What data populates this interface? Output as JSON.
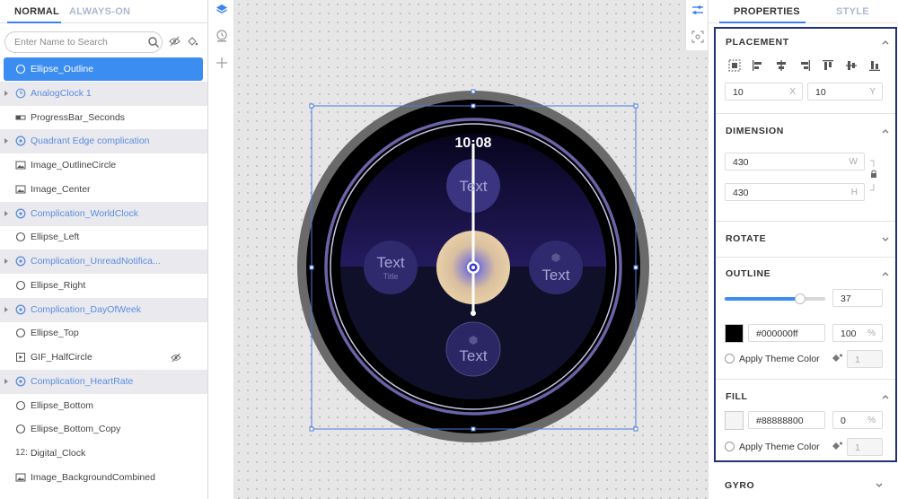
{
  "left_panel": {
    "tabs": [
      "NORMAL",
      "ALWAYS-ON"
    ],
    "search_placeholder": "Enter Name to Search",
    "layers": [
      {
        "label": "Ellipse_Outline",
        "icon": "ellipse-icon",
        "group": false,
        "selected": true
      },
      {
        "label": "AnalogClock 1",
        "icon": "clock-icon",
        "group": true
      },
      {
        "label": "ProgressBar_Seconds",
        "icon": "progressbar-icon",
        "group": false
      },
      {
        "label": "Quadrant Edge complication",
        "icon": "complication-icon",
        "group": true
      },
      {
        "label": "Image_OutlineCircle",
        "icon": "image-icon",
        "group": false
      },
      {
        "label": "Image_Center",
        "icon": "image-icon",
        "group": false
      },
      {
        "label": "Complication_WorldClock",
        "icon": "complication-icon",
        "group": true
      },
      {
        "label": "Ellipse_Left",
        "icon": "ellipse-icon",
        "group": false
      },
      {
        "label": "Complication_UnreadNotifica...",
        "icon": "complication-icon",
        "group": true
      },
      {
        "label": "Ellipse_Right",
        "icon": "ellipse-icon",
        "group": false
      },
      {
        "label": "Complication_DayOfWeek",
        "icon": "complication-icon",
        "group": true
      },
      {
        "label": "Ellipse_Top",
        "icon": "ellipse-icon",
        "group": false
      },
      {
        "label": "GIF_HalfCircle",
        "icon": "gif-icon",
        "group": false,
        "hidden": true
      },
      {
        "label": "Complication_HeartRate",
        "icon": "complication-icon",
        "group": true
      },
      {
        "label": "Ellipse_Bottom",
        "icon": "ellipse-icon",
        "group": false
      },
      {
        "label": "Ellipse_Bottom_Copy",
        "icon": "ellipse-icon",
        "group": false
      },
      {
        "label": "Digital_Clock",
        "icon": "digital-clock-icon",
        "glyph": "12:",
        "group": false
      },
      {
        "label": "Image_BackgroundCombined",
        "icon": "image-icon",
        "group": false
      }
    ]
  },
  "canvas": {
    "time": "10:08",
    "complications": {
      "top": "Text",
      "left": "Text",
      "left_sub": "Title",
      "right": "Text",
      "bottom": "Text"
    }
  },
  "properties": {
    "tabs": [
      "PROPERTIES",
      "STYLE"
    ],
    "placement": {
      "title": "PLACEMENT",
      "x": "10",
      "x_unit": "X",
      "y": "10",
      "y_unit": "Y"
    },
    "dimension": {
      "title": "DIMENSION",
      "w": "430",
      "w_unit": "W",
      "h": "430",
      "h_unit": "H"
    },
    "rotate": {
      "title": "ROTATE"
    },
    "outline": {
      "title": "OUTLINE",
      "slider_value": "37",
      "slider_fraction": 0.75,
      "color": "#000000ff",
      "opacity": "100",
      "unit": "%",
      "apply_theme": "Apply Theme Color",
      "theme_value": "1"
    },
    "fill": {
      "title": "FILL",
      "color": "#88888800",
      "opacity": "0",
      "unit": "%",
      "apply_theme": "Apply Theme Color",
      "theme_value": "1"
    },
    "gyro": {
      "title": "GYRO"
    }
  },
  "colors": {
    "accent": "#3c8df2",
    "group_row": "#e9e9ee",
    "group_text": "#5b8de0",
    "highlight_border": "#22307a",
    "outline_swatch": "#000000"
  }
}
